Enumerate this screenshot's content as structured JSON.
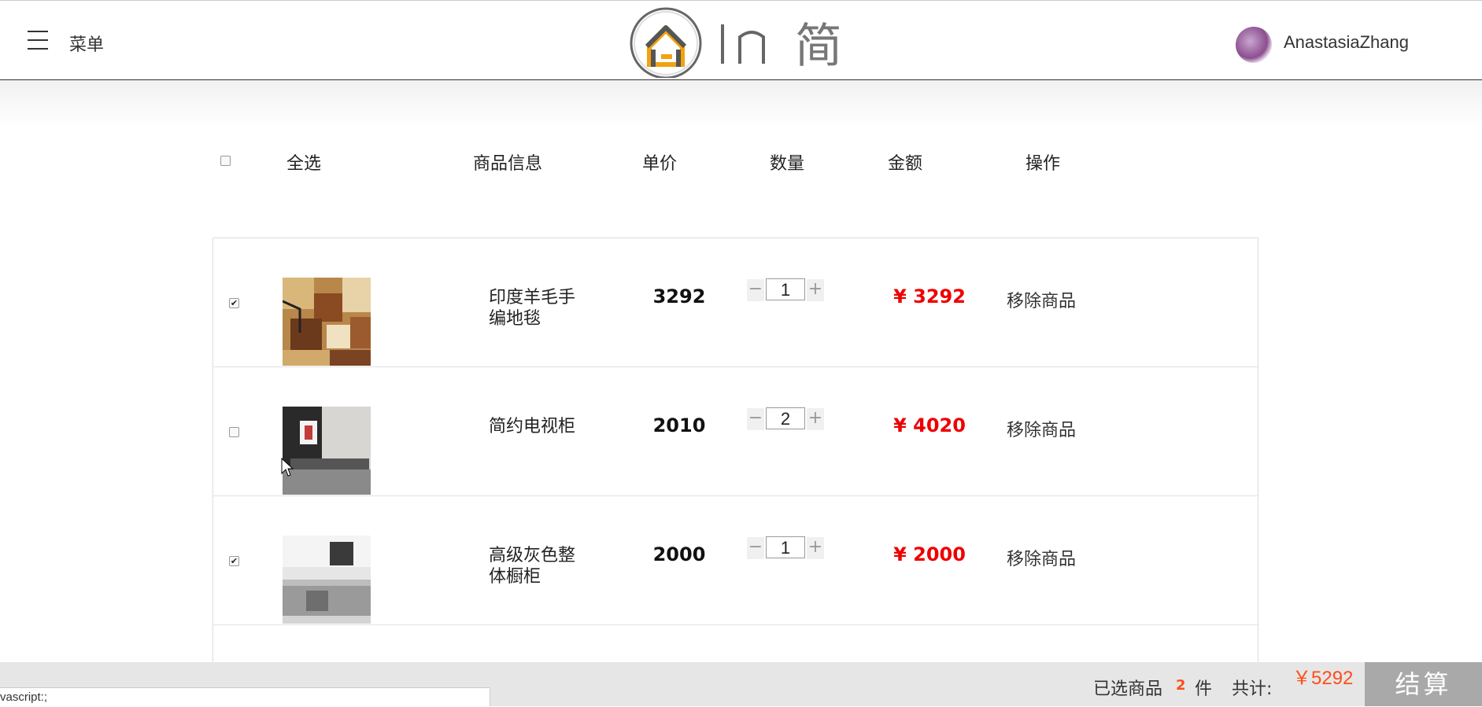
{
  "header": {
    "menu_label": "菜单",
    "logo_text": "In 简",
    "user_name": "AnastasiaZhang",
    "icons": {
      "menu": "hamburger-menu-icon",
      "logo": "house-logo-icon",
      "avatar": "user-avatar"
    }
  },
  "table_header": {
    "select_all": "全选",
    "product_info": "商品信息",
    "unit_price": "单价",
    "quantity": "数量",
    "amount": "金额",
    "actions": "操作",
    "select_all_checked": false
  },
  "cart_items": [
    {
      "name_line1": "印度羊毛手",
      "name_line2": "编地毯",
      "price": "3292",
      "quantity": "1",
      "amount": "¥ 3292",
      "remove_label": "移除商品",
      "checked": true,
      "image": "wool-rug-thumbnail"
    },
    {
      "name_line1": "简约电视柜",
      "name_line2": "",
      "price": "2010",
      "quantity": "2",
      "amount": "¥ 4020",
      "remove_label": "移除商品",
      "checked": false,
      "image": "tv-cabinet-thumbnail"
    },
    {
      "name_line1": "高级灰色整",
      "name_line2": "体橱柜",
      "price": "2000",
      "quantity": "1",
      "amount": "¥ 2000",
      "remove_label": "移除商品",
      "checked": true,
      "image": "grey-kitchen-cabinet-thumbnail"
    }
  ],
  "qty_controls": {
    "minus": "−",
    "plus": "+"
  },
  "footer": {
    "selected_label": "已选商品",
    "selected_count": "2",
    "selected_unit": "件",
    "total_label": "共计:",
    "total_value": "￥5292",
    "checkout_label": "结算",
    "status_url": "vascript:;"
  },
  "colors": {
    "accent_red": "#ee0000",
    "footer_orange": "#ff4d1a",
    "checkout_bg": "#a9a9a9",
    "footer_bg": "#e6e6e6"
  }
}
